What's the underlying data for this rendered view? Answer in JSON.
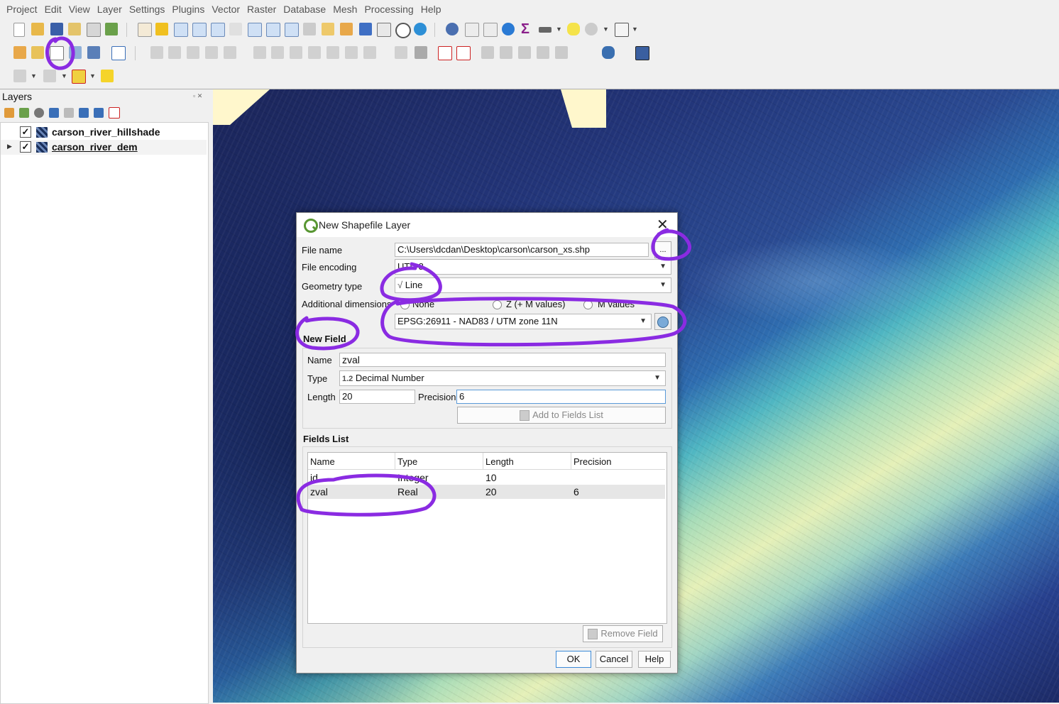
{
  "menu": [
    "Project",
    "Edit",
    "View",
    "Layer",
    "Settings",
    "Plugins",
    "Vector",
    "Raster",
    "Database",
    "Mesh",
    "Processing",
    "Help"
  ],
  "layers_panel": {
    "title": "Layers",
    "items": [
      {
        "name": "carson_river_hillshade",
        "checked": "✓"
      },
      {
        "name": "carson_river_dem",
        "checked": "✓"
      }
    ]
  },
  "dialog": {
    "title": "New Shapefile Layer",
    "close": "✕",
    "file_name_label": "File name",
    "file_name_value": "C:\\Users\\dcdan\\Desktop\\carson\\carson_xs.shp",
    "browse_label": "...",
    "encoding_label": "File encoding",
    "encoding_value": "UTF-8",
    "geometry_label": "Geometry type",
    "geometry_value": "Line",
    "dimensions_label": "Additional dimensions",
    "dim_options": [
      "None",
      "Z (+ M values)",
      "M values"
    ],
    "crs_value": "EPSG:26911 - NAD83 / UTM zone 11N",
    "new_field_heading": "New Field",
    "name_label": "Name",
    "name_value": "zval",
    "type_label": "Type",
    "type_prefix": "1.2",
    "type_value": "Decimal Number",
    "length_label": "Length",
    "length_value": "20",
    "precision_label": "Precision",
    "precision_value": "6",
    "add_field_button": "Add to Fields List",
    "fields_list_heading": "Fields List",
    "columns": [
      "Name",
      "Type",
      "Length",
      "Precision"
    ],
    "rows": [
      {
        "name": "id",
        "type": "Integer",
        "length": "10",
        "precision": ""
      },
      {
        "name": "zval",
        "type": "Real",
        "length": "20",
        "precision": "6"
      }
    ],
    "remove_field_button": "Remove Field",
    "ok_button": "OK",
    "cancel_button": "Cancel",
    "help_button": "Help"
  },
  "colors": {
    "annotation": "#8a2be2",
    "qgis_green": "#589632",
    "selection": "#e6e6e6"
  }
}
